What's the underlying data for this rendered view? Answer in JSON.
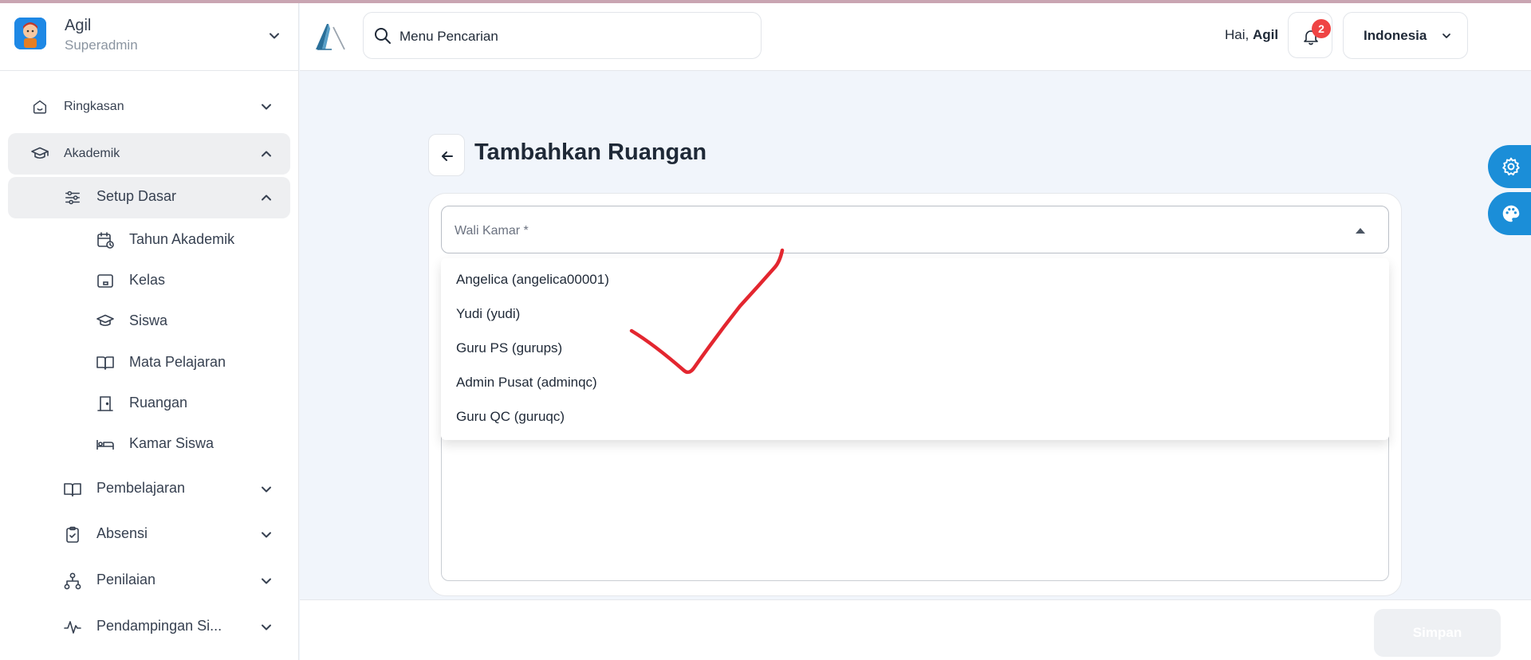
{
  "user": {
    "name": "Agil",
    "role": "Superadmin"
  },
  "sidebar": {
    "items": [
      {
        "label": "Ringkasan",
        "icon": "home-icon",
        "level": 1,
        "expanded": false
      },
      {
        "label": "Akademik",
        "icon": "graduation-cap-icon",
        "level": 1,
        "expanded": true
      },
      {
        "label": "Setup Dasar",
        "icon": "sliders-icon",
        "level": 2,
        "expanded": true
      },
      {
        "label": "Tahun Akademik",
        "icon": "calendar-clock-icon",
        "level": 3
      },
      {
        "label": "Kelas",
        "icon": "tablet-icon",
        "level": 3
      },
      {
        "label": "Siswa",
        "icon": "graduation-cap-icon",
        "level": 3
      },
      {
        "label": "Mata Pelajaran",
        "icon": "book-open-icon",
        "level": 3
      },
      {
        "label": "Ruangan",
        "icon": "door-icon",
        "level": 3
      },
      {
        "label": "Kamar Siswa",
        "icon": "bed-icon",
        "level": 3
      },
      {
        "label": "Pembelajaran",
        "icon": "book-open-icon",
        "level": 2,
        "expanded": false
      },
      {
        "label": "Absensi",
        "icon": "clipboard-check-icon",
        "level": 2,
        "expanded": false
      },
      {
        "label": "Penilaian",
        "icon": "hierarchy-icon",
        "level": 2,
        "expanded": false
      },
      {
        "label": "Pendampingan Si...",
        "icon": "activity-icon",
        "level": 2,
        "expanded": false
      }
    ]
  },
  "header": {
    "search_placeholder": "Menu Pencarian",
    "greeting_prefix": "Hai, ",
    "greeting_name": "Agil",
    "notification_count": "2",
    "language": "Indonesia"
  },
  "page": {
    "title": "Tambahkan Ruangan",
    "select_label": "Wali Kamar *",
    "options": [
      "Angelica (angelica00001)",
      "Yudi (yudi)",
      "Guru PS (gurups)",
      "Admin Pusat (adminqc)",
      "Guru QC (guruqc)"
    ]
  },
  "footer": {
    "save_label": "Simpan"
  },
  "colors": {
    "accent": "#1b8ed8",
    "badge": "#ef4444",
    "annotation": "#e3262f",
    "active_bg": "#eeeff1"
  }
}
